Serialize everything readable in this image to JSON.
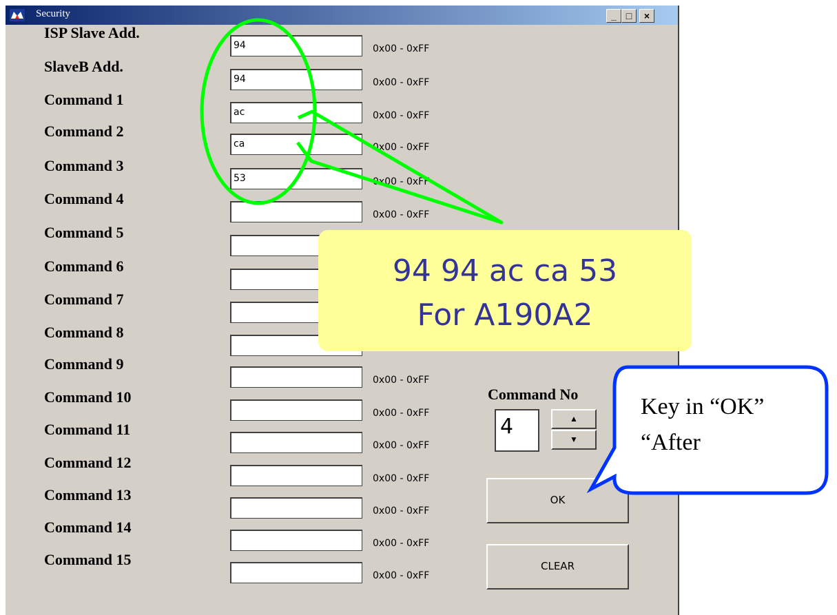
{
  "window": {
    "title": "Security",
    "buttons": {
      "minimize": "_",
      "maximize": "□",
      "close": "×"
    }
  },
  "fields": [
    {
      "label": "ISP Slave Add.",
      "value": "94",
      "range": "0x00 - 0xFF"
    },
    {
      "label": "SlaveB Add.",
      "value": "94",
      "range": "0x00 - 0xFF"
    },
    {
      "label": "Command 1",
      "value": "ac",
      "range": "0x00 - 0xFF"
    },
    {
      "label": "Command 2",
      "value": "ca",
      "range": "0x00 - 0xFF"
    },
    {
      "label": "Command 3",
      "value": "53",
      "range": "0x00 - 0xFF"
    },
    {
      "label": "Command 4",
      "value": "",
      "range": "0x00 - 0xFF"
    },
    {
      "label": "Command 5",
      "value": "",
      "range": ""
    },
    {
      "label": "Command 6",
      "value": "",
      "range": ""
    },
    {
      "label": "Command 7",
      "value": "",
      "range": ""
    },
    {
      "label": "Command 8",
      "value": "",
      "range": ""
    },
    {
      "label": "Command 9",
      "value": "",
      "range": "0x00 - 0xFF"
    },
    {
      "label": "Command 10",
      "value": "",
      "range": "0x00 - 0xFF"
    },
    {
      "label": "Command 11",
      "value": "",
      "range": "0x00 - 0xFF"
    },
    {
      "label": "Command 12",
      "value": "",
      "range": "0x00 - 0xFF"
    },
    {
      "label": "Command 13",
      "value": "",
      "range": "0x00 - 0xFF"
    },
    {
      "label": "Command 14",
      "value": "",
      "range": "0x00 - 0xFF"
    },
    {
      "label": "Command 15",
      "value": "",
      "range": "0x00 - 0xFF"
    }
  ],
  "command_no": {
    "label": "Command No",
    "value": "4"
  },
  "buttons": {
    "ok": "OK",
    "clear": "CLEAR"
  },
  "annotations": {
    "yellow_line1": "94 94 ac ca 53",
    "yellow_line2": "For A190A2",
    "blue_line1": "Key in “OK”",
    "blue_line2": "“After"
  },
  "colors": {
    "highlight": "#00ff00",
    "callout_fill": "#ffff99",
    "callout_text": "#333399",
    "bubble_border": "#0033ff"
  }
}
